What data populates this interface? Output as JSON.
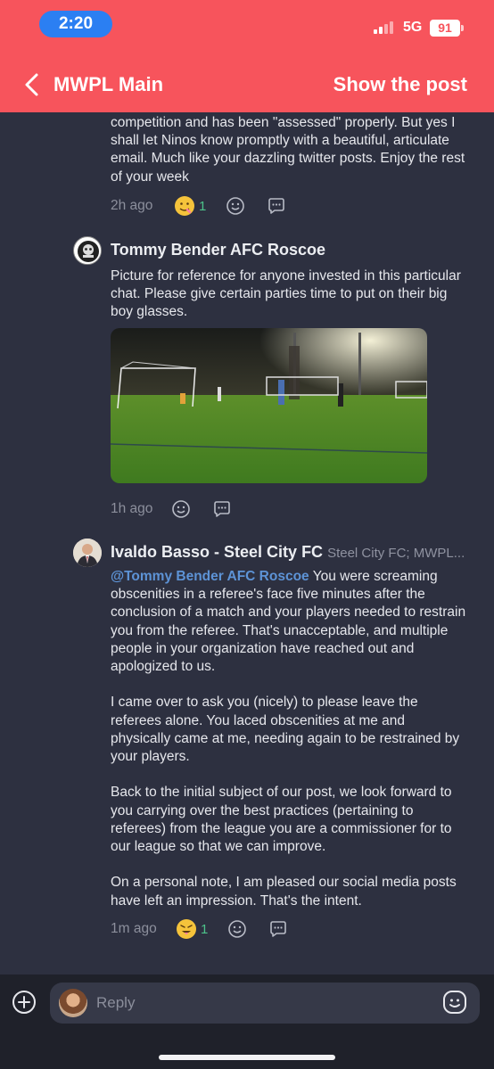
{
  "status_bar": {
    "time": "2:20",
    "network": "5G",
    "battery": "91"
  },
  "header": {
    "title": "MWPL Main",
    "action": "Show the post"
  },
  "messages": [
    {
      "lines": [
        "competition and has been \"assessed\" properly. But yes I shall let Ninos know promptly with a beautiful, articulate email. Much like your dazzling twitter posts. Enjoy the rest of your week"
      ],
      "time": "2h ago",
      "reaction_count": "1"
    },
    {
      "author": "Tommy Bender AFC Roscoe",
      "text": "Picture for reference for anyone invested in this particular chat. Please give certain parties time to put on their big boy glasses.",
      "time": "1h ago"
    },
    {
      "author": "Ivaldo Basso - Steel City FC",
      "author_sub": "Steel City FC; MWPL...",
      "mention": "@Tommy Bender AFC Roscoe",
      "p1_rest": " You were screaming obscenities in a referee's face five minutes after the conclusion of a match and your players needed to restrain you from the referee. That's unacceptable, and multiple people in your organization have reached out and apologized to us.",
      "p2": "I came over to ask you (nicely) to please leave the referees alone. You laced obscenities at me and physically came at me, needing again to be restrained by your players.",
      "p3": "Back to the initial subject of our post, we look forward to you carrying over the best practices (pertaining to referees) from the league you are a commissioner for to our league so that we can improve.",
      "p4": "On a personal note, I am pleased our social media posts have left an impression. That's the intent.",
      "time": "1m ago",
      "reaction_count": "1"
    }
  ],
  "composer": {
    "placeholder": "Reply"
  },
  "icons": [
    "back-chevron-icon",
    "smiley-icon",
    "comment-icon",
    "plus-icon",
    "emoji-icon"
  ],
  "colors": {
    "header": "#f7545c",
    "background": "#2d3040",
    "mention": "#5d93d6",
    "reaction_count": "#4cc28a"
  }
}
